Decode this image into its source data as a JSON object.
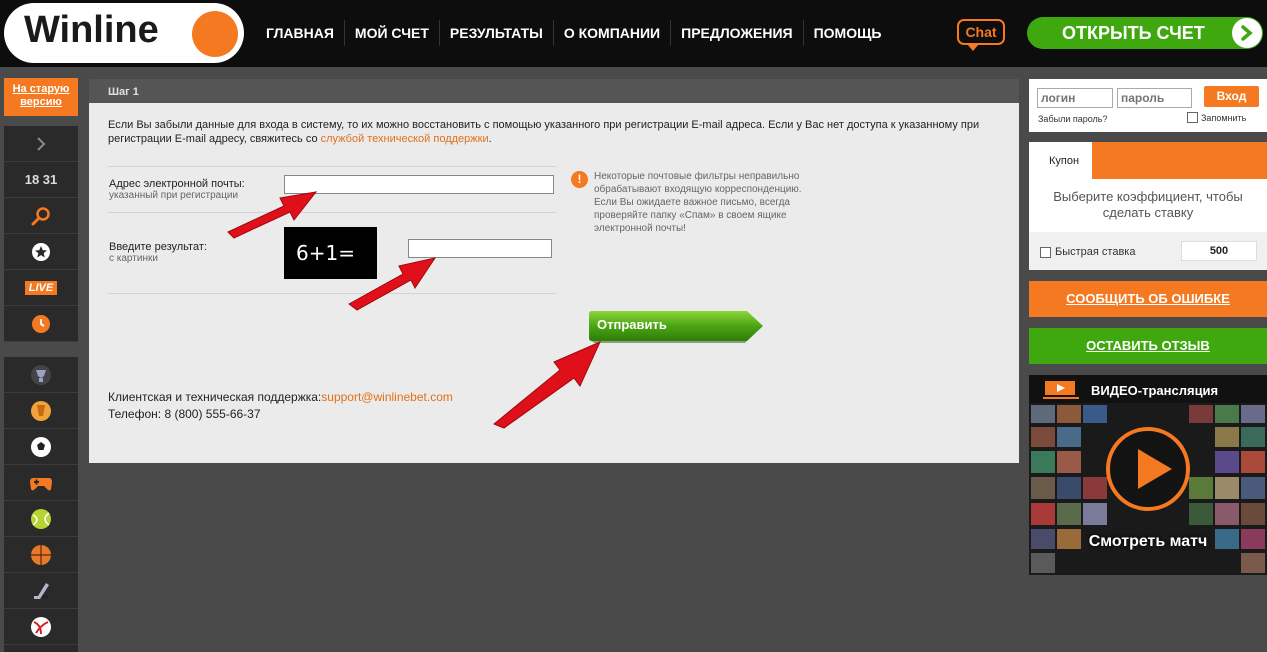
{
  "header": {
    "logo_text": "Winline",
    "nav": [
      "ГЛАВНАЯ",
      "МОЙ СЧЕТ",
      "РЕЗУЛЬТАТЫ",
      "О КОМПАНИИ",
      "ПРЕДЛОЖЕНИЯ",
      "ПОМОЩЬ"
    ],
    "chat_label": "Chat",
    "open_account_label": "ОТКРЫТЬ СЧЕТ"
  },
  "sidebar": {
    "old_version_label": "На старую версию",
    "time": "18 31",
    "live_label": "LIVE",
    "sports_icons": [
      "trophy-icon",
      "europa-league-icon",
      "football-icon",
      "esports-icon",
      "tennis-icon",
      "basketball-icon",
      "hockey-icon",
      "volleyball-icon"
    ]
  },
  "main": {
    "step_label": "Шаг 1",
    "intro_text": "Если Вы забыли данные для входа в систему, то их можно восстановить с помощью указанного при регистрации E-mail адреса. Если у Вас нет доступа к указанному при регистрации E-mail адресу, свяжитесь со ",
    "intro_link": "службой технической поддержки",
    "intro_end": ".",
    "email_label": "Адрес электронной почты:",
    "email_hint": "указанный при регистрации",
    "email_value": "",
    "captcha_label": "Введите результат:",
    "captcha_hint": "с картинки",
    "captcha_text": "6+1=",
    "captcha_value": "",
    "notice_text": "Некоторые почтовые фильтры неправильно обрабатывают входящую корреспонденцию. Если Вы ожидаете важное письмо, всегда проверяйте папку «Спам» в своем ящике электронной почты!",
    "submit_label": "Отправить",
    "support_label": "Клиентская и техническая поддержка:",
    "support_email": "support@winlinebet.com",
    "phone_label": "Телефон: ",
    "phone": "8 (800) 555-66-37"
  },
  "login": {
    "login_placeholder": "логин",
    "password_placeholder": "пароль",
    "submit_label": "Вход",
    "forgot_label": "Забыли пароль?",
    "remember_label": "Запомнить"
  },
  "coupon": {
    "tab_label": "Купон",
    "message": "Выберите коэффициент, чтобы сделать ставку",
    "quick_bet_label": "Быстрая ставка",
    "stake_value": "500"
  },
  "right_buttons": {
    "report_error": "СООБЩИТЬ ОБ ОШИБКЕ",
    "leave_review": "ОСТАВИТЬ ОТЗЫВ"
  },
  "video": {
    "title": "ВИДЕО-трансляция",
    "watch_label": "Смотреть матч"
  },
  "colors": {
    "brand_orange": "#f47920",
    "brand_green": "#3fa80f",
    "annotation_red": "#e0101a"
  }
}
